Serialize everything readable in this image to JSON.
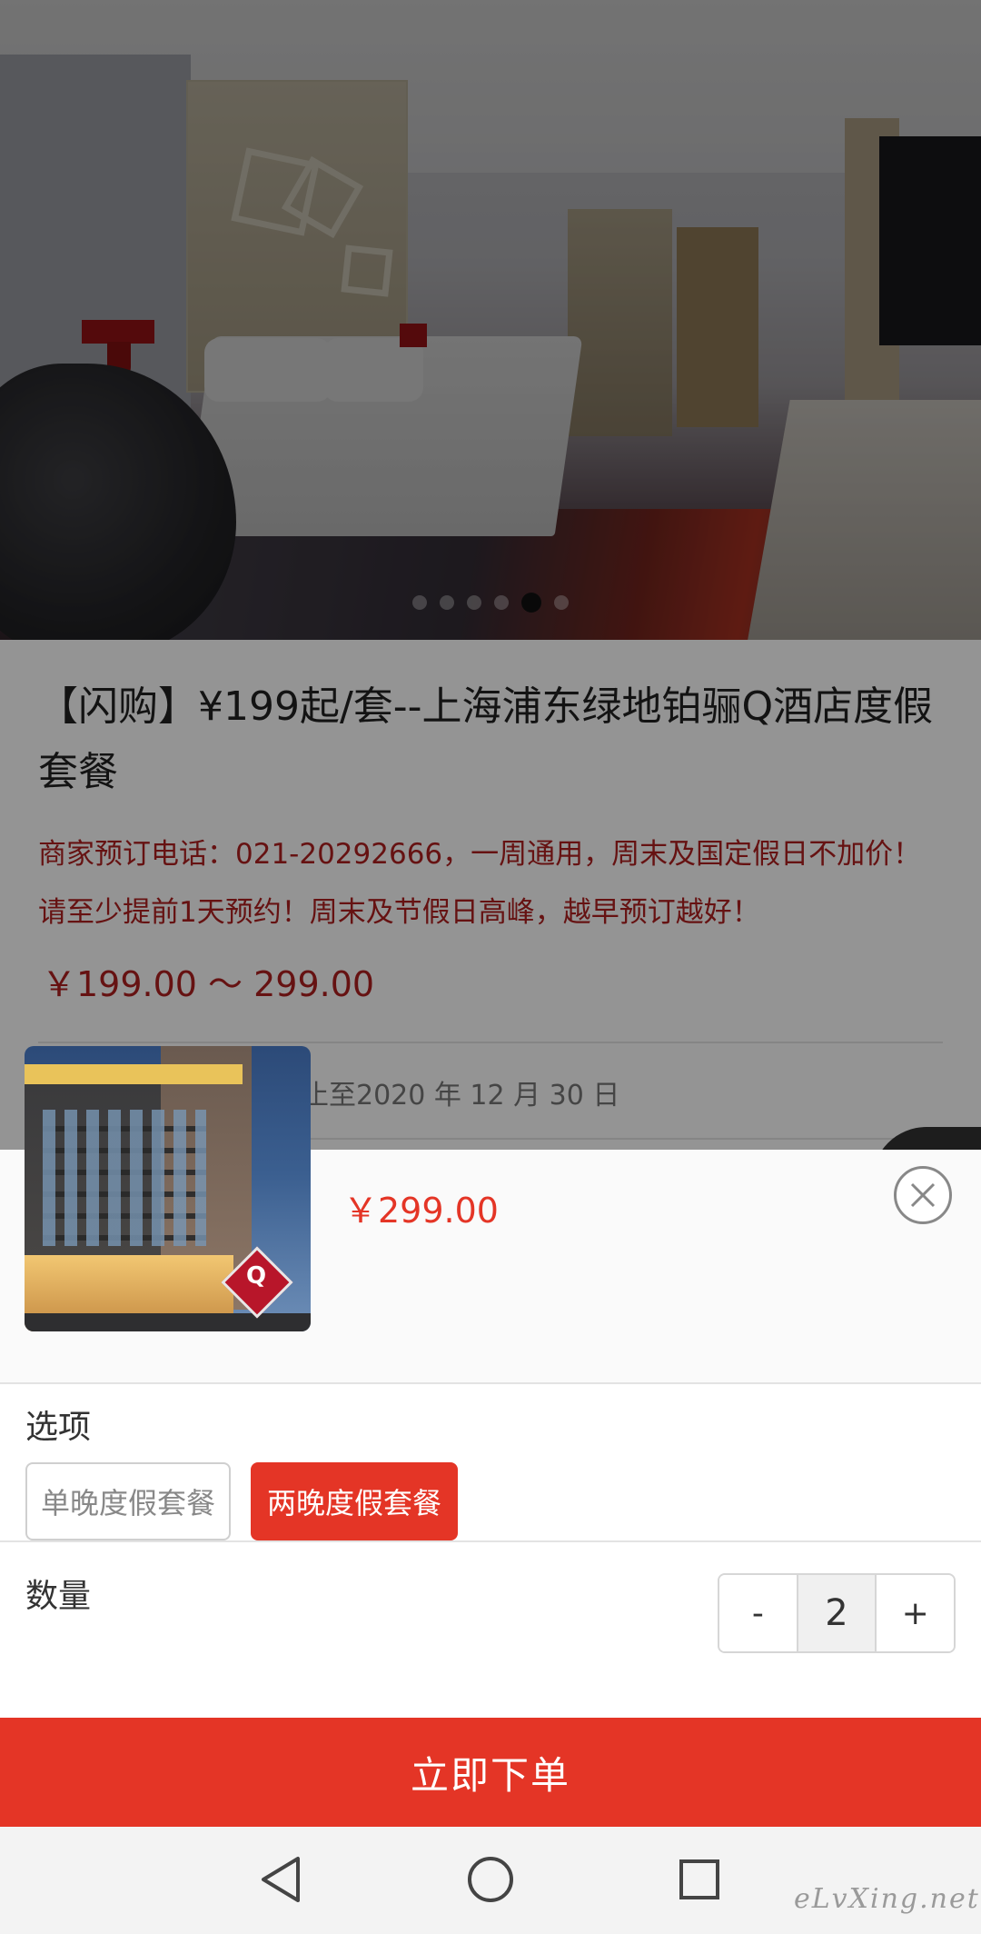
{
  "product": {
    "title": "【闪购】¥199起/套--上海浦东绿地铂骊Q酒店度假套餐",
    "description": "商家预订电话：021-20292666，一周通用，周末及国定假日不加价！请至少提前1天预约！周末及节假日高峰，越早预订越好！",
    "price_range": "￥199.00 〜 299.00",
    "validity_partial": "止至2020 年 12 月 30 日"
  },
  "gallery": {
    "dot_count": 6,
    "active_index": 4
  },
  "sheet": {
    "price": "￥299.00",
    "options_label": "选项",
    "options": [
      {
        "label": "单晚度假套餐",
        "selected": false
      },
      {
        "label": "两晚度假套餐",
        "selected": true
      }
    ],
    "quantity_label": "数量",
    "quantity": {
      "minus": "-",
      "value": "2",
      "plus": "+"
    },
    "order_button": "立即下单"
  },
  "navbar": {
    "back_icon": "back-triangle-icon",
    "home_icon": "home-circle-icon",
    "recents_icon": "recents-square-icon"
  },
  "watermark": "eLvXing.net",
  "colors": {
    "accent": "#e43526",
    "price_text": "#b02020",
    "scrim": "rgba(0,0,0,0.42)"
  }
}
